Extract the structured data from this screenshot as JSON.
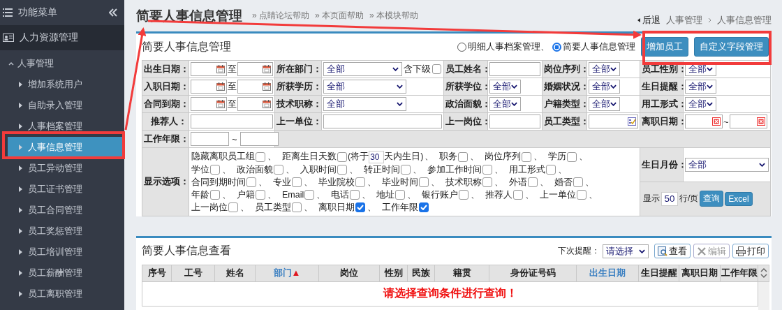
{
  "sidebar": {
    "title": "功能菜单",
    "module": "人力资源管理",
    "groups": [
      {
        "label": "人事管理",
        "expanded": true,
        "items": [
          {
            "label": "增加系统用户",
            "selected": false
          },
          {
            "label": "自助录入管理",
            "selected": false
          },
          {
            "label": "人事档案管理",
            "selected": false
          },
          {
            "label": "人事信息管理",
            "selected": true
          },
          {
            "label": "员工异动管理",
            "selected": false
          },
          {
            "label": "员工证书管理",
            "selected": false
          },
          {
            "label": "员工合同管理",
            "selected": false
          },
          {
            "label": "员工奖惩管理",
            "selected": false
          },
          {
            "label": "员工培训管理",
            "selected": false
          },
          {
            "label": "员工薪酬管理",
            "selected": false
          },
          {
            "label": "员工离职管理",
            "selected": false
          }
        ]
      }
    ]
  },
  "header": {
    "title": "简要人事信息管理",
    "help_links": [
      "» 点睛论坛帮助",
      "» 本页面帮助",
      "» 本模块帮助"
    ],
    "back": "后退",
    "breadcrumb": [
      "人事管理",
      "人事信息管理"
    ]
  },
  "search_panel": {
    "title": "简要人事信息管理",
    "views": [
      {
        "label": "明细人事档案管理、",
        "selected": false
      },
      {
        "label": "简要人事信息管理",
        "selected": true
      }
    ],
    "buttons": [
      "增加员工",
      "自定义字段管理"
    ],
    "rows": [
      [
        {
          "label": "出生日期：",
          "kind": "date_range",
          "separator": "至"
        },
        {
          "label": "所在部门：",
          "kind": "select_check",
          "value": "全部",
          "check_label": "含下级",
          "checked": false
        },
        {
          "label": "员工姓名：",
          "kind": "text"
        },
        {
          "label": "岗位序列：",
          "kind": "select",
          "value": "全部"
        },
        {
          "label": "员工性别：",
          "kind": "select",
          "value": "全部"
        }
      ],
      [
        {
          "label": "入职日期：",
          "kind": "date_range",
          "separator": "至"
        },
        {
          "label": "所获学历：",
          "kind": "select",
          "value": "全部"
        },
        {
          "label": "所获学位：",
          "kind": "select",
          "value": "全部"
        },
        {
          "label": "婚姻状况：",
          "kind": "select",
          "value": "全部"
        },
        {
          "label": "生日提醒：",
          "kind": "select",
          "value": "全部"
        }
      ],
      [
        {
          "label": "合同到期：",
          "kind": "date_range",
          "separator": "至"
        },
        {
          "label": "技术职称：",
          "kind": "select",
          "value": "全部"
        },
        {
          "label": "政治面貌：",
          "kind": "select",
          "value": "全部"
        },
        {
          "label": "户籍类型：",
          "kind": "select",
          "value": "全部"
        },
        {
          "label": "用工形式：",
          "kind": "select",
          "value": "全部"
        }
      ],
      [
        {
          "label": "推荐人：",
          "kind": "text"
        },
        {
          "label": "上一单位：",
          "kind": "text"
        },
        {
          "label": "上一岗位：",
          "kind": "text"
        },
        {
          "label": "员工类型：",
          "kind": "picker"
        },
        {
          "label": "离职日期：",
          "kind": "clear_range",
          "separator": "~"
        }
      ],
      [
        {
          "label": "工作年限：",
          "kind": "range",
          "separator": "~"
        }
      ]
    ],
    "display_options": {
      "label": "显示选项：",
      "items": [
        {
          "label": "隐藏离职员工组",
          "checked": false,
          "sep": "、"
        },
        {
          "label": "距离生日天数",
          "checked": false,
          "before": "(将于",
          "days": "30",
          "after": "天内生日)",
          "sep": "、"
        },
        {
          "label": "职务",
          "checked": false,
          "sep": "、"
        },
        {
          "label": "岗位序列",
          "checked": false,
          "sep": "、"
        },
        {
          "label": "学历",
          "checked": false,
          "sep": "、"
        },
        {
          "label": "学位",
          "checked": false,
          "sep": "、"
        },
        {
          "label": "政治面貌",
          "checked": false,
          "sep": "、"
        },
        {
          "label": "入职时间",
          "checked": false,
          "sep": "、"
        },
        {
          "label": "转正时间",
          "checked": false,
          "sep": "、"
        },
        {
          "label": "参加工作时间",
          "checked": false,
          "sep": "、"
        },
        {
          "label": "用工形式",
          "checked": false,
          "sep": "、"
        },
        {
          "label": "合同到期时间",
          "checked": false,
          "sep": "、"
        },
        {
          "label": "专业",
          "checked": false,
          "sep": "、"
        },
        {
          "label": "毕业院校",
          "checked": false,
          "sep": "、"
        },
        {
          "label": "毕业时间",
          "checked": false,
          "sep": "、"
        },
        {
          "label": "技术职称",
          "checked": false,
          "sep": "、"
        },
        {
          "label": "外语",
          "checked": false,
          "sep": "、"
        },
        {
          "label": "婚否",
          "checked": false,
          "sep": "、"
        },
        {
          "label": "年龄",
          "checked": false,
          "sep": "、"
        },
        {
          "label": "户籍",
          "checked": false,
          "sep": "、"
        },
        {
          "label": "Email",
          "checked": false,
          "sep": "、"
        },
        {
          "label": "电话",
          "checked": false,
          "sep": "、"
        },
        {
          "label": "地址",
          "checked": false,
          "sep": "、"
        },
        {
          "label": "银行账户",
          "checked": false,
          "sep": "、"
        },
        {
          "label": "推荐人",
          "checked": false,
          "sep": "、"
        },
        {
          "label": "上一单位",
          "checked": false,
          "sep": "、"
        },
        {
          "label": "上一岗位",
          "checked": false,
          "sep": "、"
        },
        {
          "label": "员工类型",
          "checked": false,
          "sep": "、"
        },
        {
          "label": "离职日期",
          "checked": true,
          "sep": "、"
        },
        {
          "label": "工作年限",
          "checked": true
        }
      ]
    },
    "birth_month": {
      "label": "生日月份：",
      "value": "全部"
    },
    "page_size": {
      "prefix": "显示",
      "value": "50",
      "suffix": "行/页"
    },
    "actions": [
      "查询",
      "Excel"
    ]
  },
  "result_panel": {
    "title": "简要人事信息查看",
    "reminder": {
      "label": "下次提醒：",
      "value": "请选择"
    },
    "tools": [
      {
        "label": "查看",
        "kind": "view",
        "disabled": false
      },
      {
        "label": "编辑",
        "kind": "edit",
        "disabled": true
      },
      {
        "label": "打印",
        "kind": "print",
        "disabled": false
      }
    ],
    "columns": [
      {
        "label": "序号",
        "link": false
      },
      {
        "label": "工号",
        "link": false
      },
      {
        "label": "姓名",
        "link": false
      },
      {
        "label": "部门",
        "link": true,
        "sort_mark": "▲"
      },
      {
        "label": "岗位",
        "link": false
      },
      {
        "label": "性别",
        "link": false
      },
      {
        "label": "民族",
        "link": false
      },
      {
        "label": "籍贯",
        "link": false
      },
      {
        "label": "身份证号码",
        "link": false
      },
      {
        "label": "出生日期",
        "link": true
      },
      {
        "label": "生日提醒",
        "link": false
      },
      {
        "label": "离职日期",
        "link": false
      },
      {
        "label": "工作年限",
        "link": false
      }
    ],
    "empty_message": "请选择查询条件进行查询！"
  }
}
